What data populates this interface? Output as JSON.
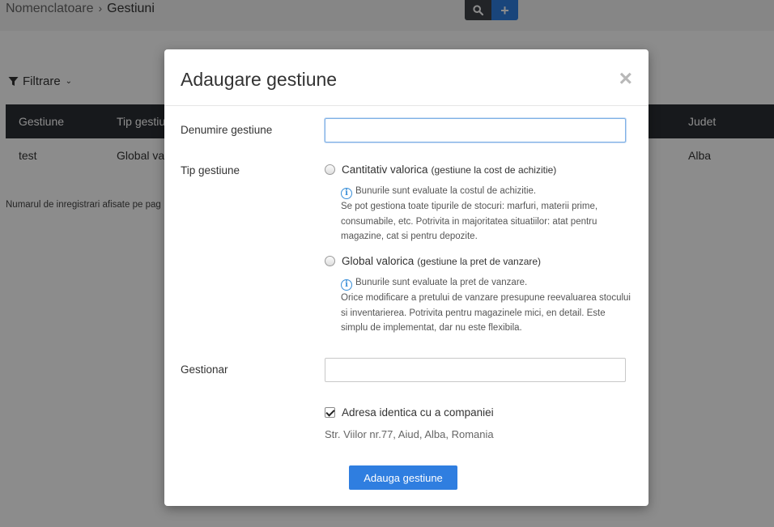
{
  "breadcrumb": {
    "parent": "Nomenclatoare",
    "separator": "›",
    "current": "Gestiuni"
  },
  "toolbar": {
    "search_icon": "search-icon",
    "add_label": "+"
  },
  "filter": {
    "label": "Filtrare",
    "chevron": "⌄"
  },
  "table": {
    "headers": [
      "Gestiune",
      "Tip gestiu",
      "Judet"
    ],
    "rows": [
      {
        "gestiune": "test",
        "tip": "Global valo",
        "judet": "Alba"
      }
    ]
  },
  "pager_text": "Numarul de inregistrari afisate pe pag",
  "modal": {
    "title": "Adaugare gestiune",
    "close": "×",
    "denumire_label": "Denumire gestiune",
    "denumire_value": "",
    "tip_label": "Tip gestiune",
    "option1": {
      "label": "Cantitativ valorica",
      "sub": "(gestiune la cost de achizitie)",
      "info_line1": "Bunurile sunt evaluate la costul de achizitie.",
      "info_rest": "Se pot gestiona toate tipurile de stocuri: marfuri, materii prime, consumabile, etc. Potrivita in majoritatea situatiilor: atat pentru magazine, cat si pentru depozite."
    },
    "option2": {
      "label": "Global valorica",
      "sub": "(gestiune la pret de vanzare)",
      "info_line1": "Bunurile sunt evaluate la pret de vanzare.",
      "info_rest": "Orice modificare a pretului de vanzare presupune reevaluarea stocului si inventarierea. Potrivita pentru magazinele mici, en detail. Este simplu de implementat, dar nu este flexibila."
    },
    "gestionar_label": "Gestionar",
    "gestionar_value": "",
    "checkbox_label": "Adresa identica cu a companiei",
    "checkbox_checked": true,
    "address": "Str. Viilor nr.77, Aiud, Alba, Romania",
    "submit_label": "Adauga gestiune"
  },
  "colors": {
    "accent": "#2f7ee0",
    "header_dark": "#2b2e33"
  }
}
